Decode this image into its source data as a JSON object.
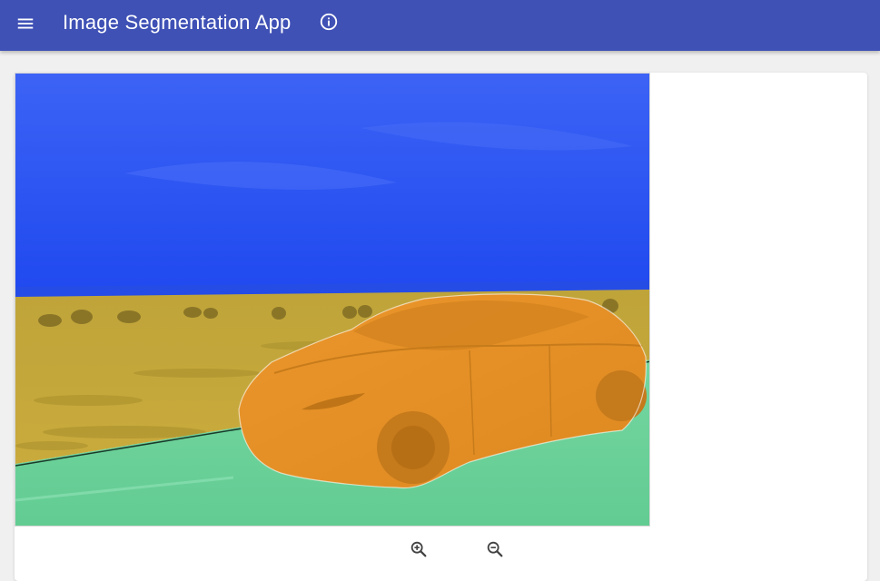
{
  "appbar": {
    "title": "Image Segmentation App",
    "color": "#3f51b5",
    "menu_icon": "menu-icon",
    "info_icon": "info-icon"
  },
  "segmentation": {
    "classes": [
      {
        "color": "#2e55f2"
      },
      {
        "color": "#c2a534"
      },
      {
        "color": "#e58f24"
      },
      {
        "color": "#6fd49a"
      }
    ]
  },
  "zoom": {
    "zoom_in_icon": "zoom-in-icon",
    "zoom_out_icon": "zoom-out-icon"
  }
}
